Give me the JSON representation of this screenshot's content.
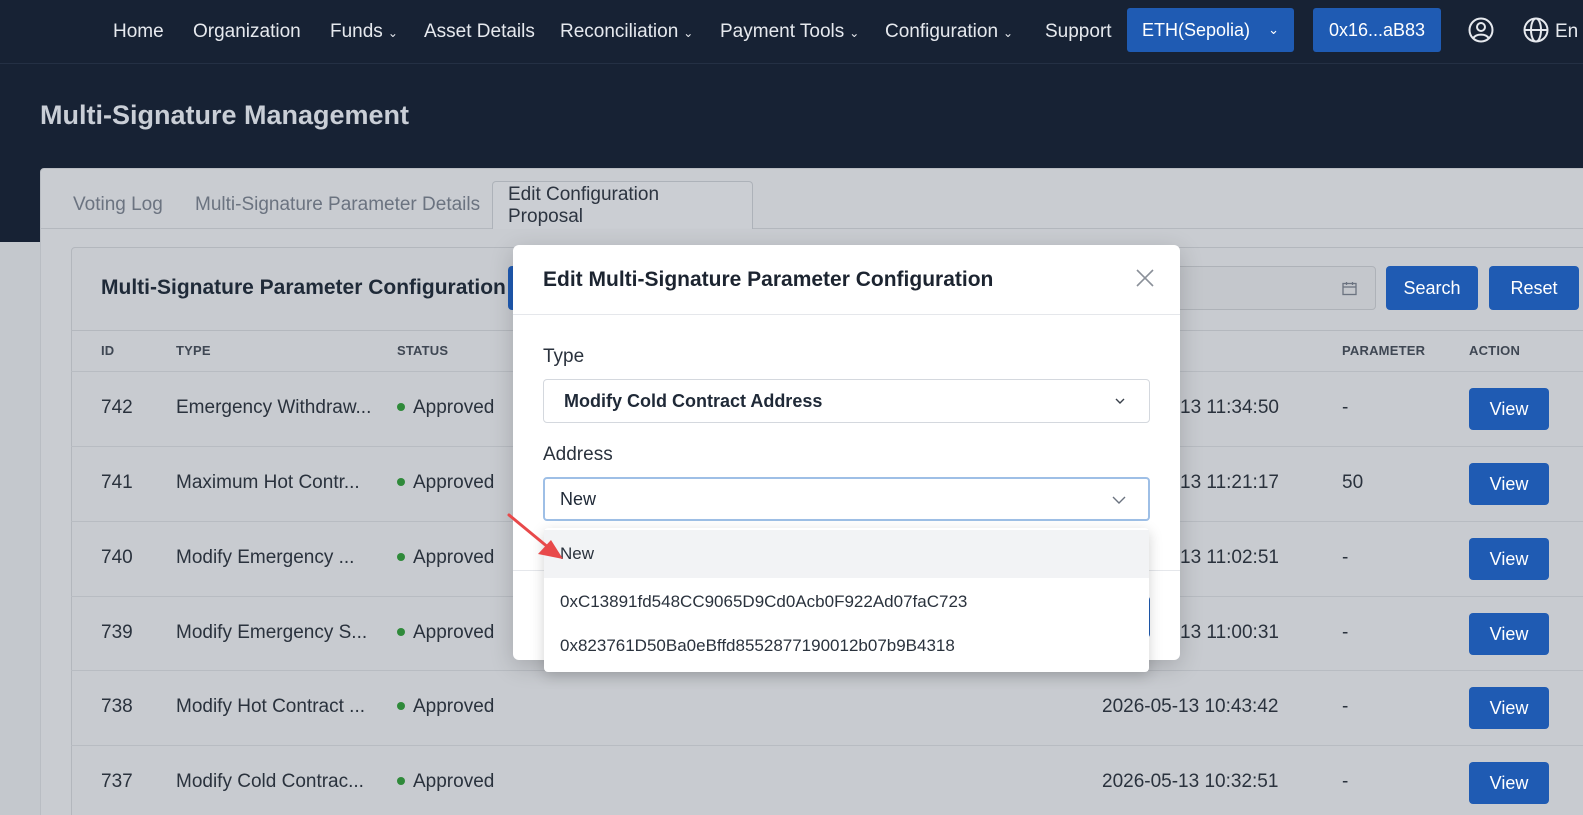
{
  "nav": {
    "items": [
      {
        "label": "Home",
        "dropdown": false
      },
      {
        "label": "Organization",
        "dropdown": false
      },
      {
        "label": "Funds",
        "dropdown": true
      },
      {
        "label": "Asset Details",
        "dropdown": false
      },
      {
        "label": "Reconciliation",
        "dropdown": true
      },
      {
        "label": "Payment Tools",
        "dropdown": true
      },
      {
        "label": "Configuration",
        "dropdown": true
      },
      {
        "label": "Support",
        "dropdown": false
      }
    ],
    "network_label": "ETH(Sepolia)",
    "wallet_label": "0x16...aB83",
    "language_label": "En",
    "icons": [
      "user-icon",
      "globe-icon"
    ]
  },
  "page": {
    "title": "Multi-Signature Management"
  },
  "tabs": [
    {
      "label": "Voting Log",
      "active": false
    },
    {
      "label": "Multi-Signature Parameter Details",
      "active": false
    },
    {
      "label": "Edit Configuration Proposal",
      "active": true
    }
  ],
  "card": {
    "title": "Multi-Signature Parameter Configuration",
    "search_label": "Search",
    "reset_label": "Reset"
  },
  "table": {
    "columns": [
      "ID",
      "TYPE",
      "STATUS",
      "PARAMETER",
      "ACTION"
    ],
    "rows": [
      {
        "id": "742",
        "type": "Emergency Withdraw...",
        "status": "Approved",
        "time": "13 11:34:50",
        "parameter": "-",
        "action": "View"
      },
      {
        "id": "741",
        "type": "Maximum Hot Contr...",
        "status": "Approved",
        "time": "13 11:21:17",
        "parameter": "50",
        "action": "View"
      },
      {
        "id": "740",
        "type": "Modify Emergency ...",
        "status": "Approved",
        "time": "13 11:02:51",
        "parameter": "-",
        "action": "View"
      },
      {
        "id": "739",
        "type": "Modify Emergency S...",
        "status": "Approved",
        "time": "13 11:00:31",
        "parameter": "-",
        "action": "View"
      },
      {
        "id": "738",
        "type": "Modify Hot Contract ...",
        "status": "Approved",
        "time": "2026-05-13 10:43:42",
        "parameter": "-",
        "action": "View"
      },
      {
        "id": "737",
        "type": "Modify Cold Contrac...",
        "status": "Approved",
        "time": "2026-05-13 10:32:51",
        "parameter": "-",
        "action": "View"
      }
    ]
  },
  "modal": {
    "title": "Edit Multi-Signature Parameter Configuration",
    "type_label": "Type",
    "type_value": "Modify Cold Contract Address",
    "address_label": "Address",
    "address_value": "New",
    "address_options": [
      "New",
      "0xC13891fd548CC9065D9Cd0Acb0F922Ad07faC723",
      "0x823761D50Ba0eBffd8552877190012b07b9B4318"
    ]
  },
  "colors": {
    "nav_bg": "#172234",
    "accent_blue": "#1f5bb3",
    "status_green": "#2f8a3a",
    "annotation_arrow": "#e8494a"
  }
}
